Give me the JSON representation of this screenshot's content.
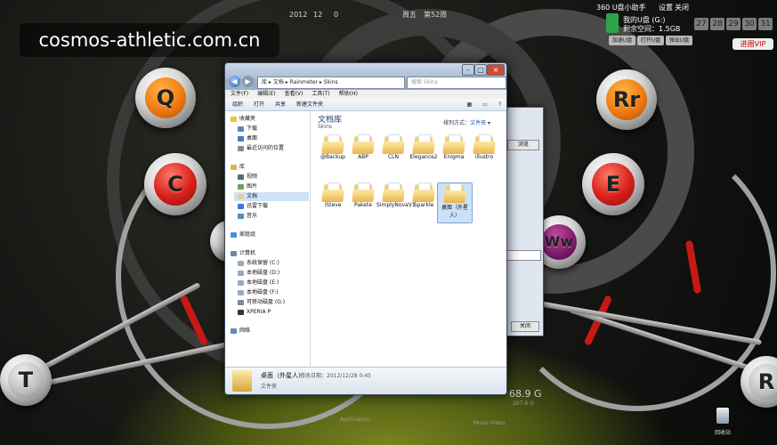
{
  "watermark": "cosmos-athletic.com.cn",
  "top": {
    "year": "2012",
    "month": "12",
    "day": "0",
    "weekday": "周五",
    "week": "第52周",
    "assistant": "360 U盘小助手",
    "settings": "设置",
    "close": "关闭",
    "drive_name": "我的U盘 (G:)",
    "free_space": "剩余空间：1.5GB",
    "btn_safe": "加速U盘",
    "btn_explore": "打开U盘",
    "btn_eject": "弹出U盘",
    "dates": [
      "27",
      "28",
      "29",
      "30",
      "31"
    ],
    "vip": "进圈VIP"
  },
  "knobs": {
    "q": "Q",
    "c": "C",
    "t": "T",
    "rr": "Rr",
    "e": "E",
    "ww": "Ww",
    "r": "R"
  },
  "explorer": {
    "address": [
      "库",
      "文档",
      "Rainmeter",
      "Skins"
    ],
    "search_placeholder": "搜索 Skins",
    "menu": [
      "文件(F)",
      "编辑(E)",
      "查看(V)",
      "工具(T)",
      "帮助(H)"
    ],
    "toolbar": [
      "组织",
      "打开",
      "共享",
      "新建文件夹"
    ],
    "nav": {
      "favorites": "收藏夹",
      "fav_items": [
        "下载",
        "桌面",
        "最近访问的位置"
      ],
      "libraries": "库",
      "lib_items": [
        "视频",
        "图片",
        "文档",
        "迅雷下载",
        "音乐"
      ],
      "homegroup": "家庭组",
      "computer": "计算机",
      "comp_items": [
        "系统保留 (C:)",
        "本地磁盘 (D:)",
        "本地磁盘 (E:)",
        "本地磁盘 (F:)",
        "可移动磁盘 (G:)",
        "XPERIA P"
      ],
      "network": "网络"
    },
    "library_title": "文档库",
    "library_sub": "Skins",
    "arrange_label": "排列方式：",
    "arrange_value": "文件夹",
    "folders_row1": [
      "@Backup",
      "ABP",
      "CLN",
      "Elegance2",
      "Enigma",
      "illustro"
    ],
    "folders_row2": [
      "iSteve",
      "Pakete",
      "SimplyNovaV1",
      "Sparkle",
      "桌面（外星人）"
    ],
    "status": {
      "name": "桌面（外星人）",
      "date_label": "修改日期：",
      "date": "2012/12/28 0:45",
      "kind": "文件夹"
    }
  },
  "behind": {
    "button": "浏览",
    "close": "关闭",
    "disk_total": "68.9 G",
    "disk_sub": "207.6 G",
    "app_label": "Application",
    "music_label": "Music Video",
    "recycle_bin": "回收站"
  }
}
